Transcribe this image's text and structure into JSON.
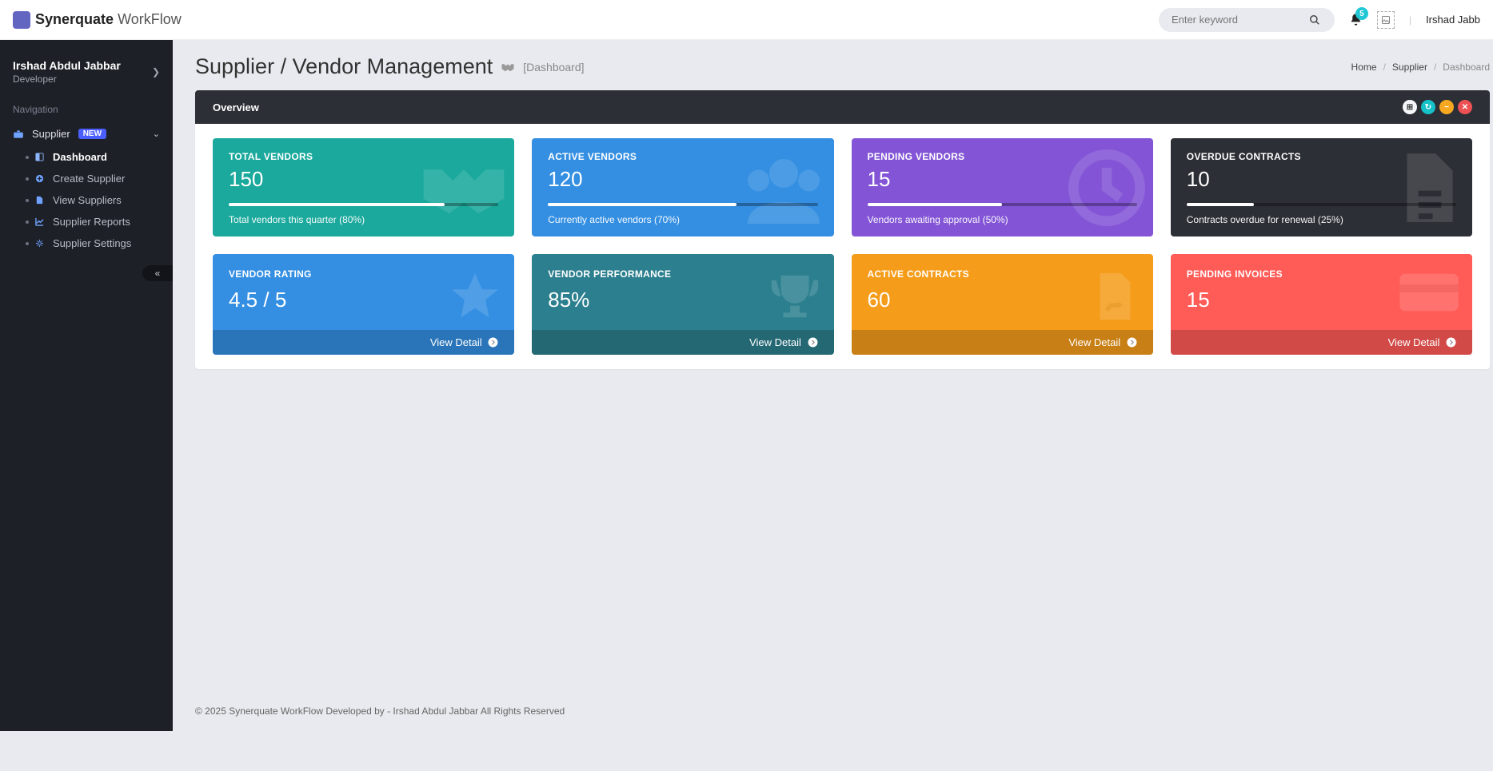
{
  "brand": {
    "strong": "Synerquate",
    "light": "WorkFlow"
  },
  "search": {
    "placeholder": "Enter keyword"
  },
  "notifications": {
    "count": "5"
  },
  "current_user": {
    "name": "Irshad Abdul Jabbar",
    "short": "Irshad Jabb",
    "role": "Developer"
  },
  "sidebar": {
    "section": "Navigation",
    "main": {
      "label": "Supplier",
      "badge": "NEW"
    },
    "items": [
      {
        "label": "Dashboard",
        "icon": "◧",
        "active": true
      },
      {
        "label": "Create Supplier",
        "icon": "➕"
      },
      {
        "label": "View Suppliers",
        "icon": "🗎"
      },
      {
        "label": "Supplier Reports",
        "icon": "📈"
      },
      {
        "label": "Supplier Settings",
        "icon": "⚙"
      }
    ]
  },
  "page": {
    "title": "Supplier / Vendor Management",
    "subtitle": "[Dashboard]",
    "crumbs": [
      "Home",
      "Supplier",
      "Dashboard"
    ]
  },
  "panel": {
    "title": "Overview"
  },
  "stats_top": [
    {
      "label": "TOTAL VENDORS",
      "value": "150",
      "sub": "Total vendors this quarter (80%)",
      "pct": 80,
      "color": "c-teal",
      "icon": "handshake"
    },
    {
      "label": "ACTIVE VENDORS",
      "value": "120",
      "sub": "Currently active vendors (70%)",
      "pct": 70,
      "color": "c-blue",
      "icon": "users"
    },
    {
      "label": "PENDING VENDORS",
      "value": "15",
      "sub": "Vendors awaiting approval (50%)",
      "pct": 50,
      "color": "c-purple",
      "icon": "clock"
    },
    {
      "label": "OVERDUE CONTRACTS",
      "value": "10",
      "sub": "Contracts overdue for renewal (25%)",
      "pct": 25,
      "color": "c-dark",
      "icon": "doc"
    }
  ],
  "stats_bottom": [
    {
      "label": "VENDOR RATING",
      "value": "4.5 / 5",
      "color": "c-blue",
      "icon": "star",
      "link": "View Detail"
    },
    {
      "label": "VENDOR PERFORMANCE",
      "value": "85%",
      "color": "c-teal",
      "icon": "trophy",
      "link": "View Detail"
    },
    {
      "label": "ACTIVE CONTRACTS",
      "value": "60",
      "color": "c-orange",
      "icon": "sign",
      "link": "View Detail"
    },
    {
      "label": "PENDING INVOICES",
      "value": "15",
      "color": "c-red",
      "icon": "card",
      "link": "View Detail"
    }
  ],
  "footer": "© 2025 Synerquate WorkFlow Developed by - Irshad Abdul Jabbar All Rights Reserved"
}
